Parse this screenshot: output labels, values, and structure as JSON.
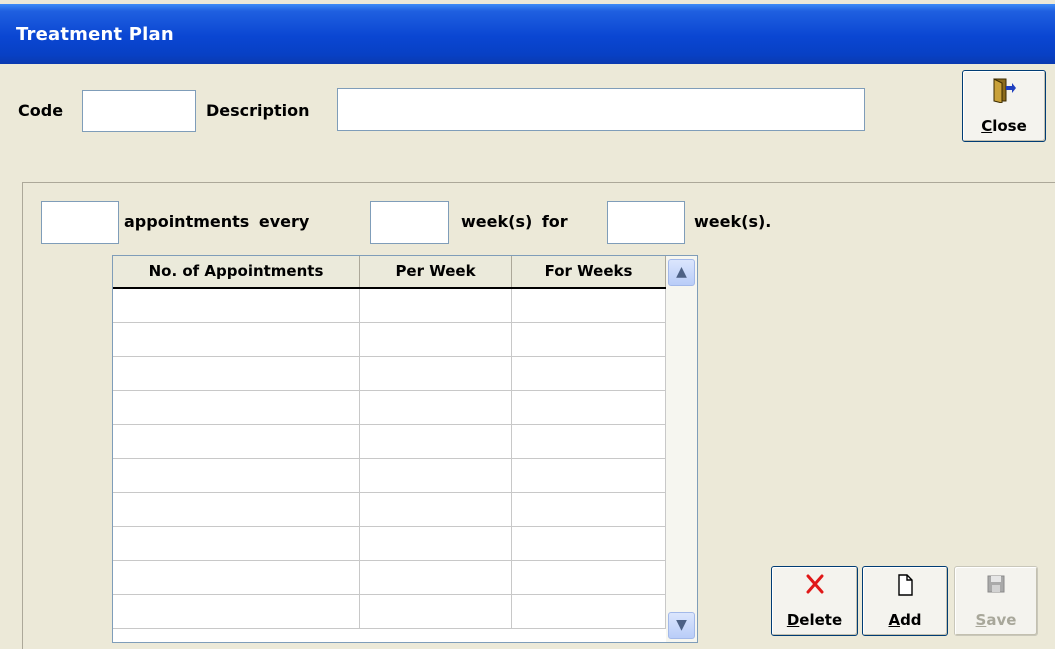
{
  "window": {
    "title": "Treatment Plan"
  },
  "header": {
    "code_label": "Code",
    "code_value": "",
    "description_label": "Description",
    "description_value": ""
  },
  "close_button": {
    "prefix": "",
    "accel": "C",
    "rest": "lose",
    "icon": "exit-door-icon"
  },
  "schedule": {
    "count_value": "",
    "text_appointments_every": "appointments every",
    "every_value": "",
    "text_weeks_for": "week(s) for",
    "for_value": "",
    "text_weeks_end": "week(s)."
  },
  "grid": {
    "columns": [
      "No. of Appointments",
      "Per Week",
      "For Weeks"
    ],
    "rows": [
      [
        "",
        "",
        ""
      ],
      [
        "",
        "",
        ""
      ],
      [
        "",
        "",
        ""
      ],
      [
        "",
        "",
        ""
      ],
      [
        "",
        "",
        ""
      ],
      [
        "",
        "",
        ""
      ],
      [
        "",
        "",
        ""
      ],
      [
        "",
        "",
        ""
      ],
      [
        "",
        "",
        ""
      ],
      [
        "",
        "",
        ""
      ]
    ],
    "scroll_up_icon": "chevron-up-icon",
    "scroll_down_icon": "chevron-down-icon"
  },
  "buttons": {
    "delete": {
      "accel": "D",
      "rest": "elete",
      "icon": "red-x-icon",
      "enabled": true
    },
    "add": {
      "accel": "A",
      "rest": "dd",
      "icon": "new-page-icon",
      "enabled": true
    },
    "save": {
      "accel": "S",
      "rest": "ave",
      "icon": "floppy-disk-icon",
      "enabled": false
    }
  }
}
